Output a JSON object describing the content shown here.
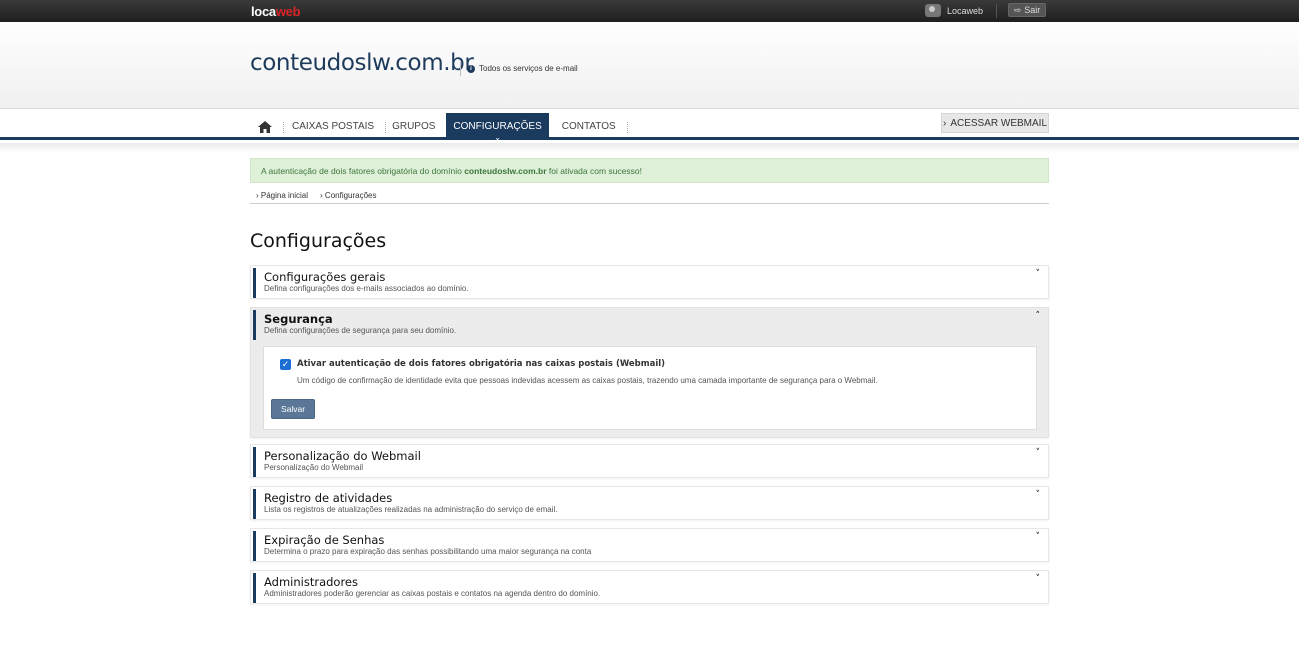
{
  "topbar": {
    "logo_part1": "loca",
    "logo_part2": "web",
    "user_label": "Locaweb",
    "logout_label": "Sair"
  },
  "header": {
    "domain": "conteudoslw.com.br",
    "all_services": "Todos os serviços de e-mail"
  },
  "nav": {
    "items": [
      {
        "label": "CAIXAS POSTAIS"
      },
      {
        "label": "GRUPOS"
      },
      {
        "label": "CONFIGURAÇÕES",
        "active": true
      },
      {
        "label": "CONTATOS"
      }
    ],
    "webmail_label": "ACESSAR WEBMAIL"
  },
  "alert": {
    "prefix": "A autenticação de dois fatores obrigatória do domínio ",
    "domain": "conteudoslw.com.br",
    "suffix": " foi ativada com sucesso!"
  },
  "breadcrumb": [
    "Página inicial",
    "Configurações"
  ],
  "page_title": "Configurações",
  "sections": [
    {
      "title": "Configurações gerais",
      "desc": "Defina configurações dos e-mails associados ao domínio.",
      "expanded": false
    },
    {
      "title": "Segurança",
      "desc": "Defina configurações de segurança para seu domínio.",
      "expanded": true
    },
    {
      "title": "Personalização do Webmail",
      "desc": "Personalização do Webmail",
      "expanded": false
    },
    {
      "title": "Registro de atividades",
      "desc": "Lista os registros de atualizações realizadas na administração do serviço de email.",
      "expanded": false
    },
    {
      "title": "Expiração de Senhas",
      "desc": "Determina o prazo para expiração das senhas possibilitando uma maior segurança na conta",
      "expanded": false
    },
    {
      "title": "Administradores",
      "desc": "Administradores poderão gerenciar as caixas postais e contatos na agenda dentro do domínio.",
      "expanded": false
    }
  ],
  "security": {
    "checkbox_checked": true,
    "checkbox_label": "Ativar autenticação de dois fatores obrigatória nas caixas postais (Webmail)",
    "checkbox_desc": "Um código de confirmação de identidade evita que pessoas indevidas acessem as caixas postais, trazendo uma camada importante de segurança para o Webmail.",
    "save_label": "Salvar"
  },
  "colors": {
    "brand_navy": "#1a3a5e",
    "logo_red": "#d7262a",
    "alert_bg": "#dff0d8",
    "checkbox_blue": "#1c6ed2",
    "save_button": "#5a7797"
  }
}
